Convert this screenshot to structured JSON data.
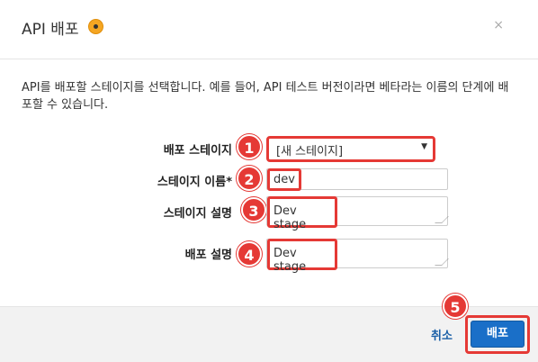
{
  "dialog": {
    "title": "API 배포",
    "close_glyph": "×",
    "description": "API를 배포할 스테이지를 선택합니다. 예를 들어, API 테스트 버전이라면 베타라는 이름의 단계에 배포할 수 있습니다."
  },
  "form": {
    "stage_label": "배포 스테이지",
    "stage_value": "[새 스테이지]",
    "stage_name_label": "스테이지 이름*",
    "stage_name_value": "dev",
    "stage_desc_label": "스테이지 설명",
    "stage_desc_value": "Dev stage",
    "deploy_desc_label": "배포 설명",
    "deploy_desc_value": "Dev stage"
  },
  "badges": [
    "1",
    "2",
    "3",
    "4",
    "5"
  ],
  "footer": {
    "cancel_label": "취소",
    "deploy_label": "배포"
  },
  "colors": {
    "highlight": "#e53935",
    "primary": "#1a6fc8",
    "info": "#f5a623"
  }
}
